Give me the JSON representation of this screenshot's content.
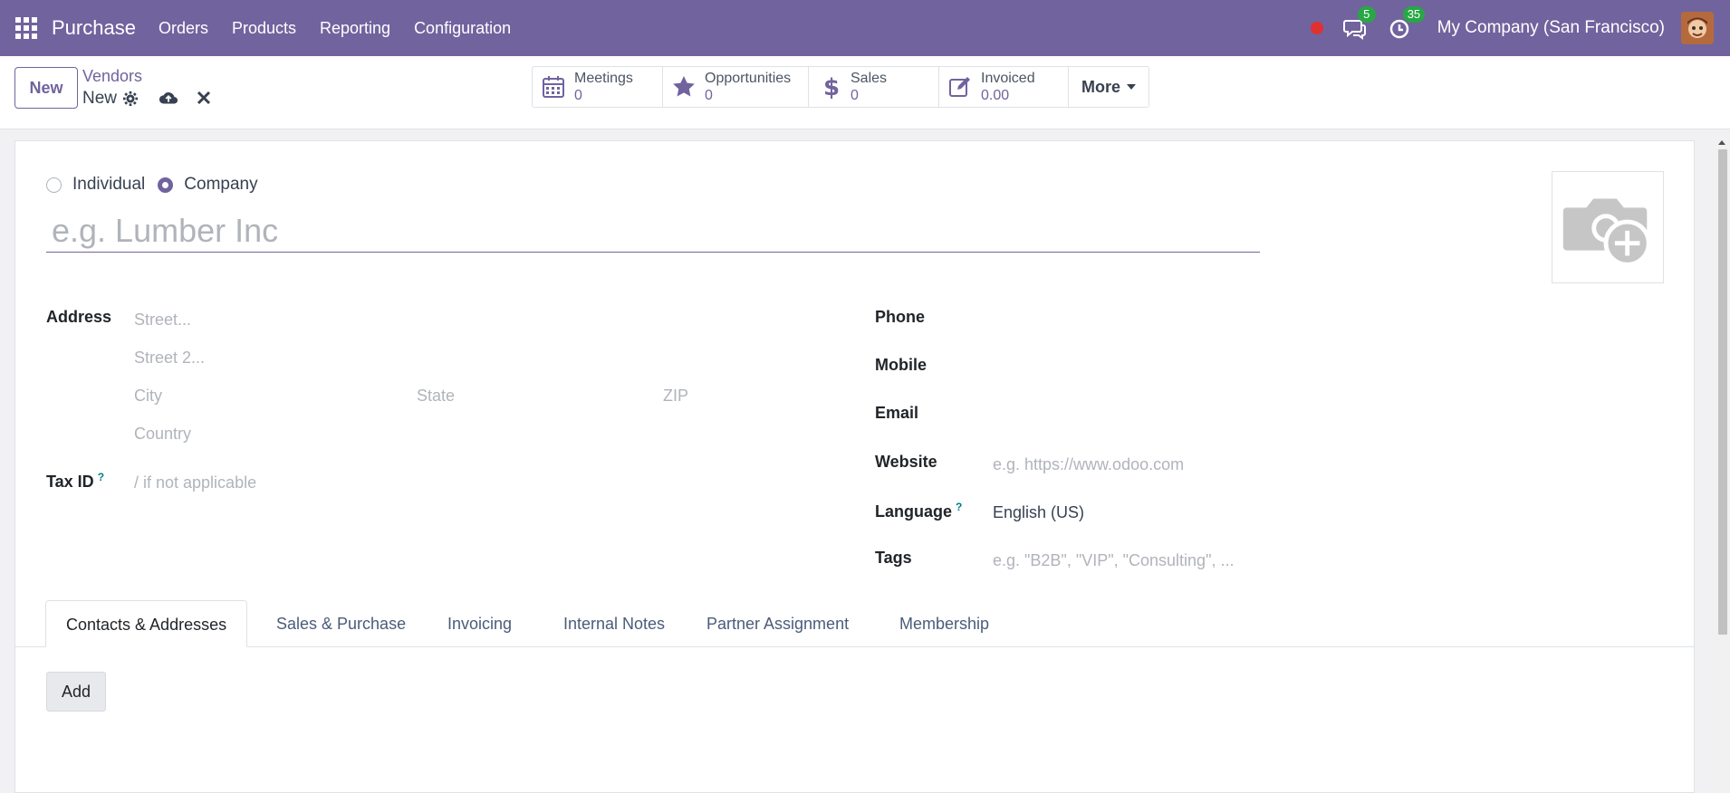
{
  "navbar": {
    "app_name": "Purchase",
    "menus": [
      "Orders",
      "Products",
      "Reporting",
      "Configuration"
    ],
    "messages_count": "5",
    "activities_count": "35",
    "company": "My Company (San Francisco)",
    "accent": "#71639e"
  },
  "control": {
    "new_label": "New",
    "breadcrumb_parent": "Vendors",
    "breadcrumb_current": "New"
  },
  "stats": [
    {
      "label": "Meetings",
      "value": "0",
      "icon": "calendar-icon"
    },
    {
      "label": "Opportunities",
      "value": "0",
      "icon": "star-icon"
    },
    {
      "label": "Sales",
      "value": "0",
      "icon": "dollar-icon"
    },
    {
      "label": "Invoiced",
      "value": "0.00",
      "icon": "edit-icon"
    }
  ],
  "more_label": "More",
  "form": {
    "type_individual": "Individual",
    "type_company": "Company",
    "name_placeholder": "e.g. Lumber Inc",
    "address_label": "Address",
    "street_placeholder": "Street...",
    "street2_placeholder": "Street 2...",
    "city_placeholder": "City",
    "state_placeholder": "State",
    "zip_placeholder": "ZIP",
    "country_placeholder": "Country",
    "taxid_label": "Tax ID",
    "taxid_help": "?",
    "taxid_placeholder": "/ if not applicable",
    "phone_label": "Phone",
    "mobile_label": "Mobile",
    "email_label": "Email",
    "website_label": "Website",
    "website_placeholder": "e.g. https://www.odoo.com",
    "language_label": "Language",
    "language_help": "?",
    "language_value": "English (US)",
    "tags_label": "Tags",
    "tags_placeholder": "e.g. \"B2B\", \"VIP\", \"Consulting\", ..."
  },
  "tabs": [
    "Contacts & Addresses",
    "Sales & Purchase",
    "Invoicing",
    "Internal Notes",
    "Partner Assignment",
    "Membership"
  ],
  "add_label": "Add"
}
